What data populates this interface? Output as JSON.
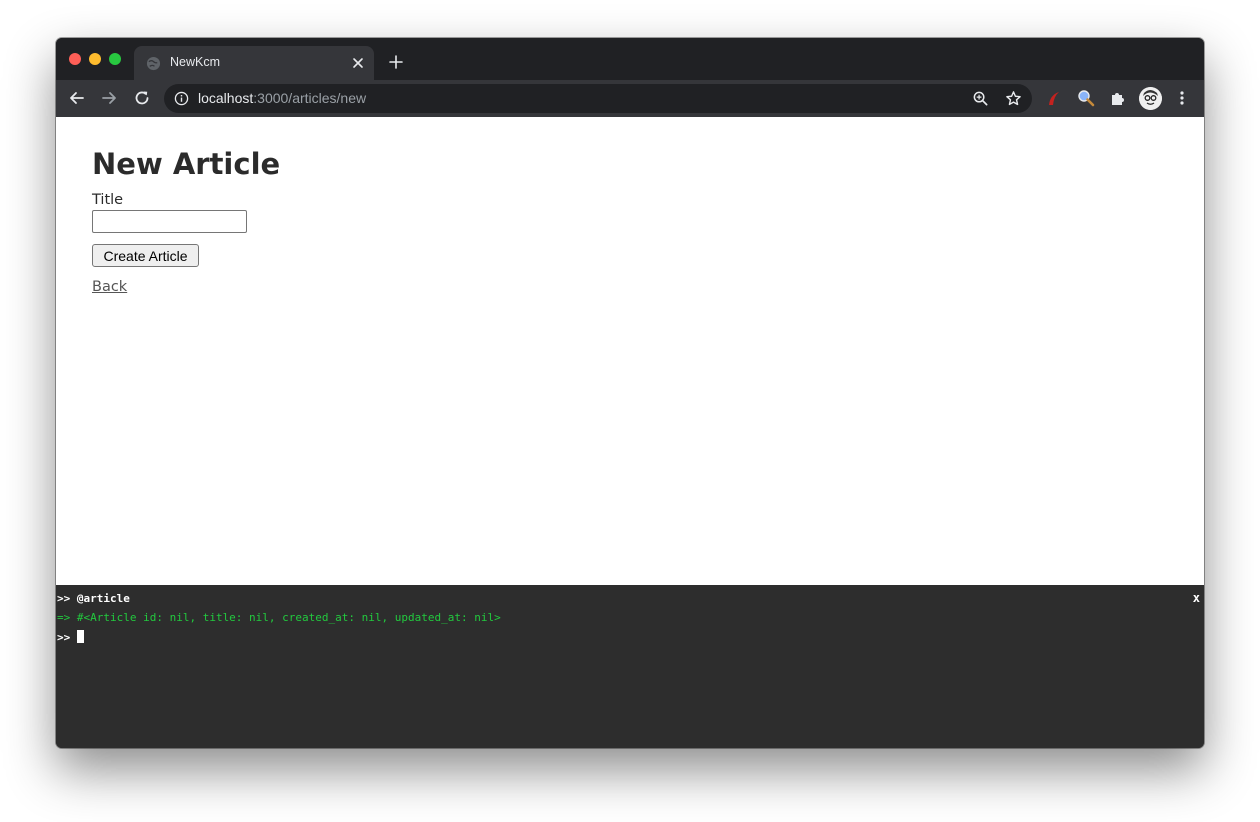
{
  "browser": {
    "tab": {
      "title": "NewKcm"
    },
    "address_bar": {
      "host": "localhost",
      "path": ":3000/articles/new"
    }
  },
  "page": {
    "title": "New Article",
    "form": {
      "title_label": "Title",
      "title_value": "",
      "submit_label": "Create Article"
    },
    "back_link": "Back"
  },
  "console": {
    "line1": ">> @article",
    "line2": "=> #<Article id: nil, title: nil, created_at: nil, updated_at: nil>",
    "prompt": ">> ",
    "close_label": "x",
    "colors": {
      "output": "#22c93e",
      "background": "#2d2d2d"
    }
  },
  "icons": {
    "tab_favicon": "globe-icon",
    "tab_close": "close-icon",
    "new_tab": "plus-icon",
    "back": "arrow-left-icon",
    "forward": "arrow-right-icon",
    "reload": "reload-icon",
    "site_info": "info-icon",
    "zoom": "zoom-icon",
    "bookmark": "star-icon",
    "extension_1": "red-extension-icon",
    "extension_2": "magnifier-extension-icon",
    "extensions": "puzzle-icon",
    "profile": "avatar",
    "menu": "kebab-menu-icon"
  }
}
